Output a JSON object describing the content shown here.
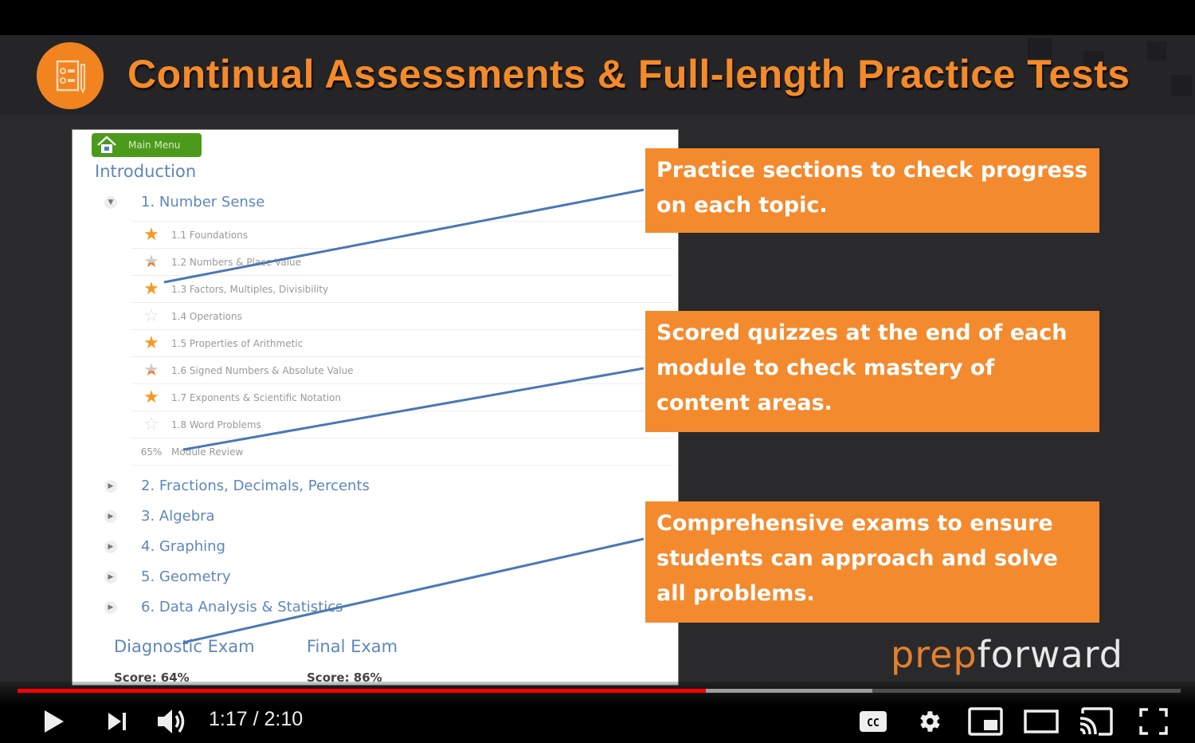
{
  "slide": {
    "title": "Continual Assessments & Full-length Practice Tests",
    "header_icon": "checklist-document-icon",
    "accent_color": "#f48a2a"
  },
  "course_screen": {
    "main_menu_label": "Main Menu",
    "intro_label": "Introduction",
    "expanded_module": "1. Number Sense",
    "lessons": [
      {
        "label": "1.1 Foundations",
        "star": "full"
      },
      {
        "label": "1.2 Numbers & Place Value",
        "star": "half"
      },
      {
        "label": "1.3 Factors, Multiples, Divisibility",
        "star": "full"
      },
      {
        "label": "1.4 Operations",
        "star": "empty"
      },
      {
        "label": "1.5 Properties of Arithmetic",
        "star": "full"
      },
      {
        "label": "1.6 Signed Numbers & Absolute Value",
        "star": "half"
      },
      {
        "label": "1.7 Exponents & Scientific Notation",
        "star": "full"
      },
      {
        "label": "1.8 Word Problems",
        "star": "empty"
      }
    ],
    "module_review": {
      "percent": "65%",
      "label": "Module Review"
    },
    "collapsed_modules": [
      "2. Fractions, Decimals, Percents",
      "3. Algebra",
      "4. Graphing",
      "5. Geometry",
      "6. Data Analysis & Statistics"
    ],
    "exams": [
      {
        "label": "Diagnostic Exam",
        "score": "Score: 64%"
      },
      {
        "label": "Final Exam",
        "score": "Score: 86%"
      }
    ]
  },
  "callouts": [
    "Practice sections to check progress on each topic.",
    "Scored quizzes at the end of each module to check mastery of content areas.",
    "Comprehensive exams to ensure students can approach and solve all problems."
  ],
  "logo": {
    "part1": "prep",
    "part2": "forward"
  },
  "player": {
    "current_time": "1:17",
    "duration": "2:10",
    "time_display": "1:17 / 2:10",
    "played_fraction": 0.592,
    "buffered_fraction": 0.735,
    "progress_color": "#ff0000",
    "buttons": [
      "play",
      "next",
      "volume",
      "captions",
      "settings",
      "miniplayer",
      "theater",
      "cast",
      "fullscreen"
    ]
  }
}
